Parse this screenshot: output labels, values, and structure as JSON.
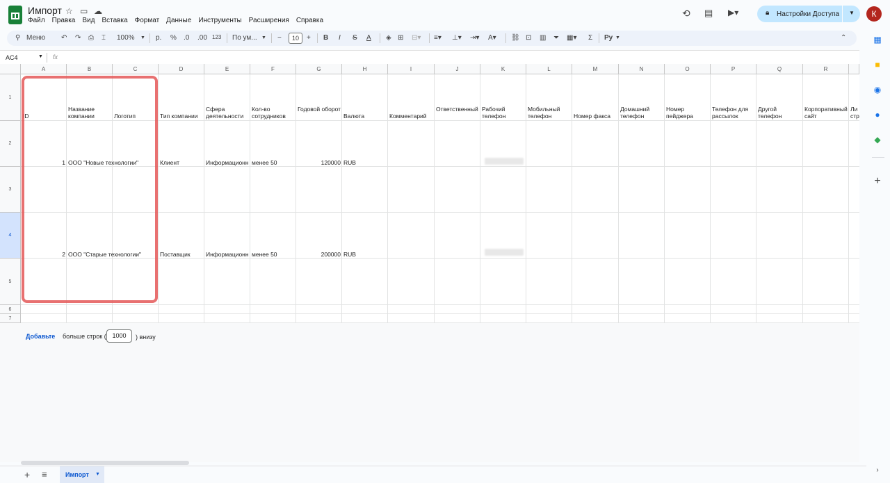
{
  "app": {
    "title": "Импорт",
    "menu": [
      "Файл",
      "Правка",
      "Вид",
      "Вставка",
      "Формат",
      "Данные",
      "Инструменты",
      "Расширения",
      "Справка"
    ],
    "share_label": "Настройки Доступа",
    "avatar_letter": "К",
    "accent": "#0b57d0",
    "highlight_color": "#e45858"
  },
  "toolbar": {
    "search": "Меню",
    "zoom": "100%",
    "currency": "р.",
    "percent": "%",
    "dec_less": ".0",
    "dec_more": ".00",
    "format_123": "123",
    "font": "По ум...",
    "font_size": "10",
    "bold": "B",
    "italic": "I",
    "strike": "S",
    "text_color": "A",
    "sum": "Σ",
    "script": "Ру"
  },
  "formula_bar": {
    "cell_ref": "AC4",
    "fx": "fx"
  },
  "columns": [
    "A",
    "B",
    "C",
    "D",
    "E",
    "F",
    "G",
    "H",
    "I",
    "J",
    "K",
    "L",
    "M",
    "N",
    "O",
    "P",
    "Q",
    "R"
  ],
  "rows": [
    "1",
    "2",
    "3",
    "4",
    "5",
    "6",
    "7"
  ],
  "headers": [
    "ID",
    "Название компании",
    "Логотип",
    "Тип компании",
    "Сфера деятельности",
    "Кол-во сотрудников",
    "Годовой оборот",
    "Валюта",
    "Комментарий",
    "Ответственный",
    "Рабочий телефон",
    "Мобильный телефон",
    "Номер факса",
    "Домашний телефон",
    "Номер пейджера",
    "Телефон для рассылок",
    "Другой телефон",
    "Корпоративный сайт",
    "Ли стр"
  ],
  "data": [
    {
      "id": "1",
      "name": "ООО \"Новые технологии\"",
      "type": "Клиент",
      "sphere": "Информационн",
      "emp": "менее 50",
      "turnover": "120000",
      "currency": "RUB"
    },
    {
      "id": "2",
      "name": "ООО \"Старые технологии\"",
      "type": "Поставщик",
      "sphere": "Информационн",
      "emp": "менее 50",
      "turnover": "200000",
      "currency": "RUB"
    }
  ],
  "add_rows": {
    "link": "Добавьте",
    "text1": "больше строк (",
    "count": "1000",
    "text2": ") внизу"
  },
  "sheet_tab": "Импорт"
}
